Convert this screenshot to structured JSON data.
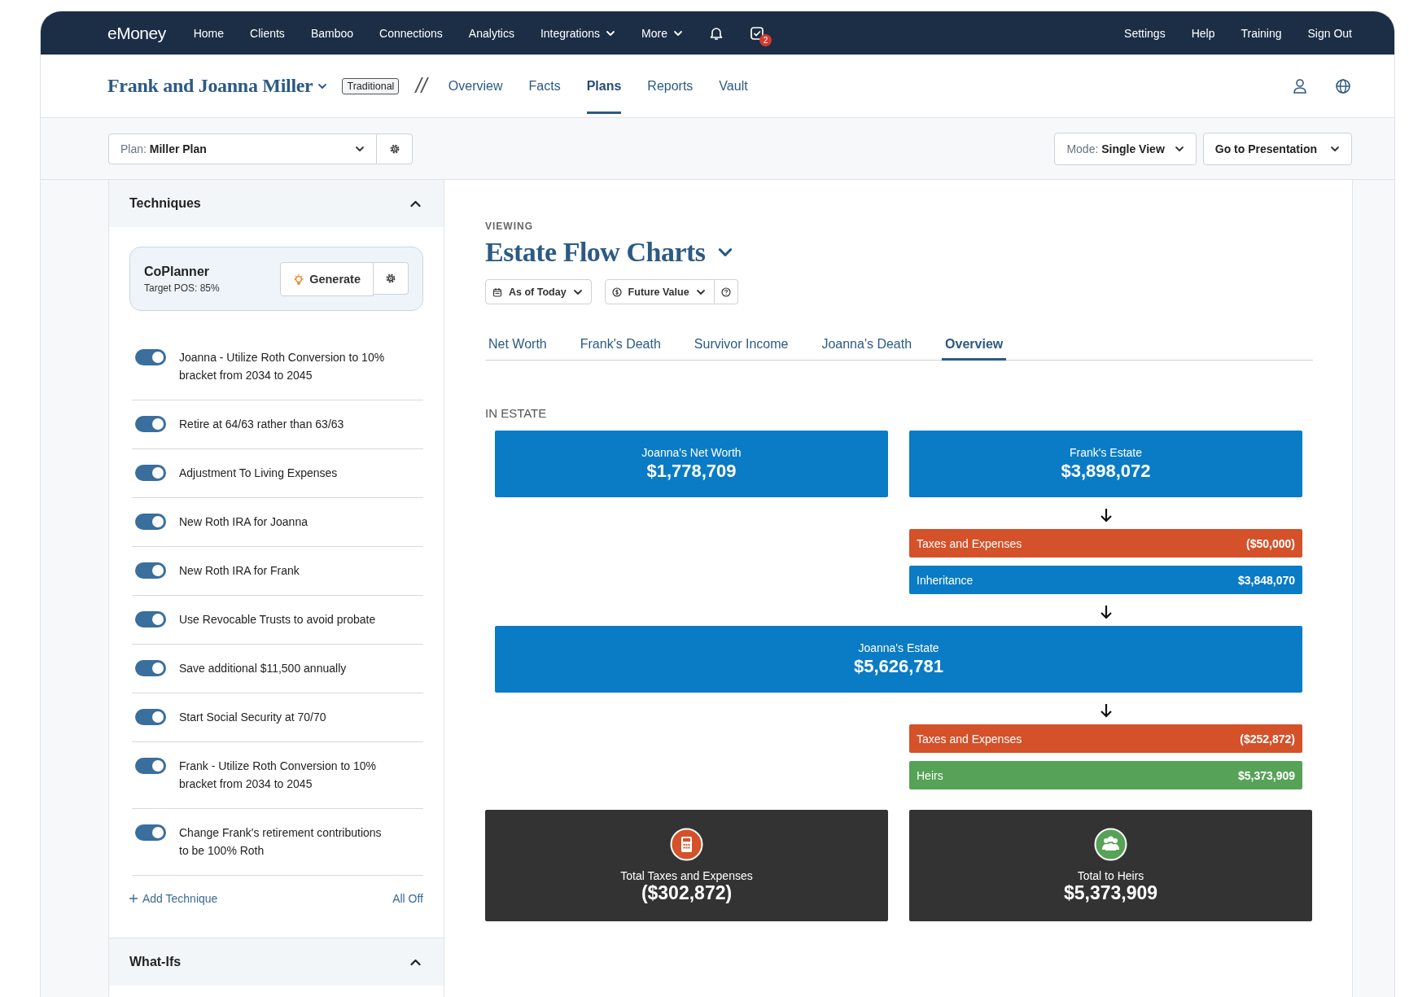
{
  "nav": {
    "logo": "eMoney",
    "items": [
      {
        "label": "Home",
        "dropdown": false
      },
      {
        "label": "Clients",
        "dropdown": false
      },
      {
        "label": "Bamboo",
        "dropdown": false
      },
      {
        "label": "Connections",
        "dropdown": false
      },
      {
        "label": "Analytics",
        "dropdown": false
      },
      {
        "label": "Integrations",
        "dropdown": true
      },
      {
        "label": "More",
        "dropdown": true
      }
    ],
    "tasks_badge": "2",
    "right_items": [
      "Settings",
      "Help",
      "Training",
      "Sign Out"
    ]
  },
  "client": {
    "name": "Frank and Joanna Miller",
    "tag": "Traditional",
    "separator": "//",
    "tabs": [
      {
        "label": "Overview",
        "selected": false
      },
      {
        "label": "Facts",
        "selected": false
      },
      {
        "label": "Plans",
        "selected": true
      },
      {
        "label": "Reports",
        "selected": false
      },
      {
        "label": "Vault",
        "selected": false
      }
    ]
  },
  "plan_bar": {
    "plan": "Plan: **Miller Plan**",
    "mode": "Mode: **Single View**",
    "presentation": "Go to Presentation"
  },
  "techniques": {
    "title": "Techniques",
    "expanded": true,
    "coplanner": {
      "title": "CoPlanner",
      "subtitle": "Target POS: 85%",
      "button": "Generate"
    },
    "items": [
      {
        "label": "Joanna - Utilize Roth Conversion to 10% bracket from 2034 to 2045",
        "on": true
      },
      {
        "label": "Retire at 64/63 rather than 63/63",
        "on": true
      },
      {
        "label": "Adjustment To Living Expenses",
        "on": true
      },
      {
        "label": "New Roth IRA for Joanna",
        "on": true
      },
      {
        "label": "New Roth IRA for Frank",
        "on": true
      },
      {
        "label": "Use Revocable Trusts to avoid probate",
        "on": true
      },
      {
        "label": "Save additional $11,500 annually",
        "on": true
      },
      {
        "label": "Start Social Security at 70/70",
        "on": true
      },
      {
        "label": "Frank - Utilize Roth Conversion to 10% bracket from 2034 to 2045",
        "on": true
      },
      {
        "label": "Change Frank's retirement contributions to be 100% Roth",
        "on": true
      }
    ],
    "add_link": "Add Technique",
    "all_off": "All Off"
  },
  "what_ifs": {
    "title": "What-Ifs",
    "expanded": true
  },
  "viewing": {
    "eyebrow": "VIEWING",
    "title": "Estate Flow Charts",
    "filters": [
      "As of Today",
      "Future Value"
    ],
    "tabs": [
      {
        "label": "Net Worth",
        "selected": false
      },
      {
        "label": "Frank's Death",
        "selected": false
      },
      {
        "label": "Survivor Income",
        "selected": false
      },
      {
        "label": "Joanna's Death",
        "selected": false
      },
      {
        "label": "Overview",
        "selected": true
      }
    ],
    "section_label": "IN ESTATE",
    "flow": [
      {
        "kind": "pair",
        "boxes": [
          {
            "label": "Joanna's Net Worth",
            "value": "$1,778,709"
          },
          {
            "label": "Frank's Estate",
            "value": "$3,898,072"
          }
        ]
      },
      {
        "kind": "arrow"
      },
      {
        "kind": "bar",
        "label": "Taxes and Expenses",
        "value": "($50,000)",
        "color": "#d4512a"
      },
      {
        "kind": "bar",
        "label": "Inheritance",
        "value": "$3,848,070",
        "color": "#0a7bc5"
      },
      {
        "kind": "arrow"
      },
      {
        "kind": "wide",
        "label": "Joanna's Estate",
        "value": "$5,626,781"
      },
      {
        "kind": "arrow"
      },
      {
        "kind": "bar",
        "label": "Taxes and Expenses",
        "value": "($252,872)",
        "color": "#d4512a"
      },
      {
        "kind": "bar",
        "label": "Heirs",
        "value": "$5,373,909",
        "color": "#56a257"
      },
      {
        "kind": "totals",
        "cards": [
          {
            "label": "Total Taxes and Expenses",
            "value": "($302,872)",
            "color": "#d4512a"
          },
          {
            "label": "Total to Heirs",
            "value": "$5,373,909",
            "color": "#56a257"
          }
        ]
      }
    ]
  }
}
